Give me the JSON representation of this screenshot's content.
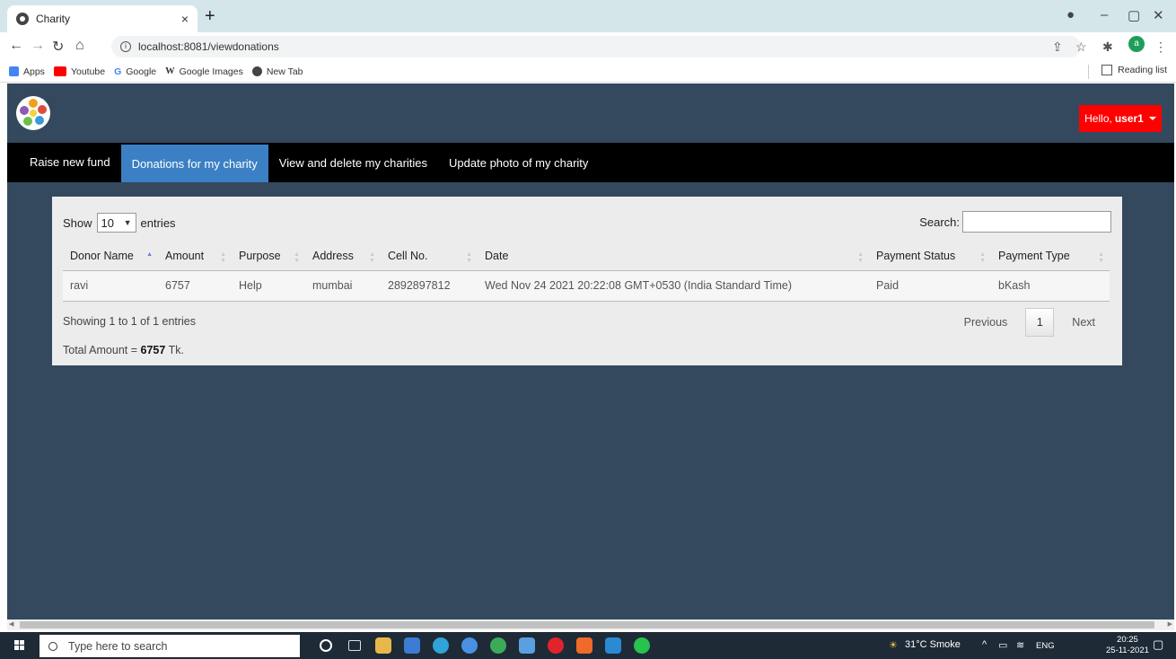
{
  "browser": {
    "tab_title": "Charity",
    "tab_close": "×",
    "new_tab": "+",
    "url": "localhost:8081/viewdonations",
    "bookmarks": [
      {
        "label": "Apps",
        "color": "#4285f4"
      },
      {
        "label": "Youtube",
        "color": "#ff0000"
      },
      {
        "label": "Google",
        "color": "#4285f4"
      },
      {
        "label": "Google Images",
        "color": "#333333"
      },
      {
        "label": "New Tab",
        "color": "#444444"
      }
    ],
    "reading_list": "Reading list",
    "profile_initial": "a"
  },
  "header": {
    "hello_prefix": "Hello,",
    "username": "user1"
  },
  "nav": {
    "items": [
      {
        "label": "Raise new fund"
      },
      {
        "label": "Donations for my charity"
      },
      {
        "label": "View and delete my charities"
      },
      {
        "label": "Update photo of my charity"
      }
    ]
  },
  "table_controls": {
    "show_label": "Show",
    "entries_value": "10",
    "entries_label": "entries",
    "search_label": "Search:"
  },
  "table": {
    "columns": [
      "Donor Name",
      "Amount",
      "Purpose",
      "Address",
      "Cell No.",
      "Date",
      "Payment Status",
      "Payment Type"
    ],
    "rows": [
      [
        "ravi",
        "6757",
        "Help",
        "mumbai",
        "2892897812",
        "Wed Nov 24 2021 20:22:08 GMT+0530 (India Standard Time)",
        "Paid",
        "bKash"
      ]
    ]
  },
  "footer": {
    "showing": "Showing 1 to 1 of 1 entries",
    "total_prefix": "Total Amount = ",
    "total_value": "6757",
    "total_suffix": " Tk.",
    "previous": "Previous",
    "page": "1",
    "next": "Next"
  },
  "taskbar": {
    "search_placeholder": "Type here to search",
    "weather": "31°C  Smoke",
    "lang": "ENG",
    "time": "20:25",
    "date": "25-11-2021"
  },
  "colors": {
    "page_bg": "#34495e",
    "active_tab": "#3b80c4",
    "hello_button": "#ff0000"
  }
}
